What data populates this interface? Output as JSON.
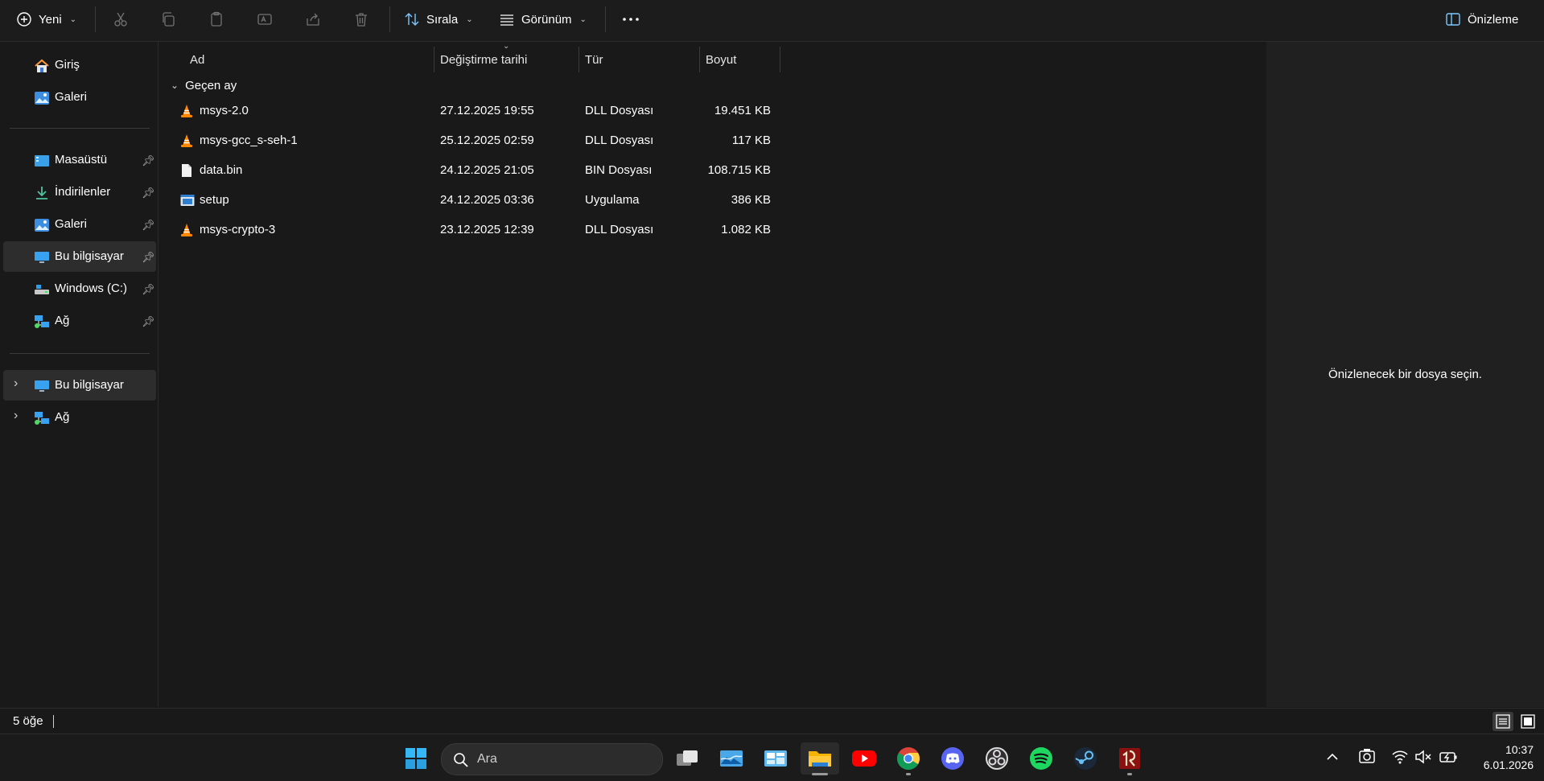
{
  "toolbar": {
    "new_label": "Yeni",
    "sort_label": "Sırala",
    "view_label": "Görünüm",
    "preview_label": "Önizleme",
    "icons": [
      "plus-circle-icon",
      "cut-icon",
      "copy-icon",
      "paste-icon",
      "rename-icon",
      "share-icon",
      "delete-icon",
      "sort-icon",
      "view-icon",
      "more-icon",
      "preview-pane-icon"
    ]
  },
  "sidebar": {
    "quick": [
      {
        "label": "Giriş",
        "icon": "home-icon"
      },
      {
        "label": "Galeri",
        "icon": "gallery-icon"
      }
    ],
    "pinned": [
      {
        "label": "Masaüstü",
        "icon": "desktop-icon",
        "pinned": true
      },
      {
        "label": "İndirilenler",
        "icon": "download-icon",
        "pinned": true
      },
      {
        "label": "Galeri",
        "icon": "gallery-icon",
        "pinned": true
      },
      {
        "label": "Bu bilgisayar",
        "icon": "computer-icon",
        "pinned": true,
        "selected": true
      },
      {
        "label": "Windows (C:)",
        "icon": "drive-icon",
        "pinned": true
      },
      {
        "label": "Ağ",
        "icon": "network-icon",
        "pinned": true
      }
    ],
    "tree": [
      {
        "label": "Bu bilgisayar",
        "icon": "computer-icon"
      },
      {
        "label": "Ağ",
        "icon": "network-icon"
      }
    ]
  },
  "columns": {
    "name": "Ad",
    "modified": "Değiştirme tarihi",
    "type": "Tür",
    "size": "Boyut"
  },
  "group": {
    "label": "Geçen ay"
  },
  "files": [
    {
      "name": "msys-2.0",
      "modified": "27.12.2025 19:55",
      "type": "DLL Dosyası",
      "size": "19.451 KB",
      "icon": "vlc-cone-icon"
    },
    {
      "name": "msys-gcc_s-seh-1",
      "modified": "25.12.2025 02:59",
      "type": "DLL Dosyası",
      "size": "117 KB",
      "icon": "vlc-cone-icon"
    },
    {
      "name": "data.bin",
      "modified": "24.12.2025 21:05",
      "type": "BIN Dosyası",
      "size": "108.715 KB",
      "icon": "blank-file-icon"
    },
    {
      "name": "setup",
      "modified": "24.12.2025 03:36",
      "type": "Uygulama",
      "size": "386 KB",
      "icon": "application-icon"
    },
    {
      "name": "msys-crypto-3",
      "modified": "23.12.2025 12:39",
      "type": "DLL Dosyası",
      "size": "1.082 KB",
      "icon": "vlc-cone-icon"
    }
  ],
  "preview": {
    "message": "Önizlenecek bir dosya seçin."
  },
  "status": {
    "count": "5 öğe"
  },
  "taskbar": {
    "search_placeholder": "Ara",
    "apps": [
      "windows-start-icon",
      "task-view-icon",
      "photos-icon",
      "widgets-icon",
      "file-explorer-icon",
      "youtube-icon",
      "chrome-icon",
      "discord-icon",
      "obs-icon",
      "spotify-icon",
      "steam-icon",
      "winrar-icon"
    ],
    "time": "10:37",
    "date": "6.01.2026"
  },
  "colors": {
    "accent": "#4cc2ff",
    "selection": "#2d2d2d",
    "vlc_orange": "#ff8800"
  }
}
